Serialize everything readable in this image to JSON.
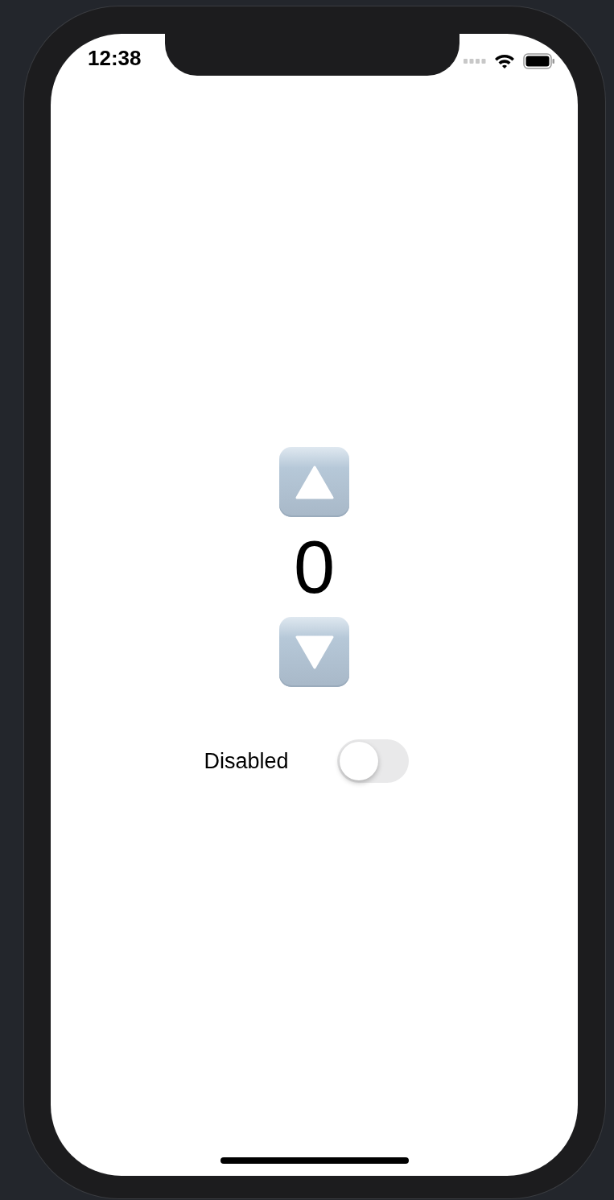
{
  "status_bar": {
    "time": "12:38"
  },
  "stepper": {
    "value": "0"
  },
  "toggle": {
    "label": "Disabled",
    "on": false
  }
}
